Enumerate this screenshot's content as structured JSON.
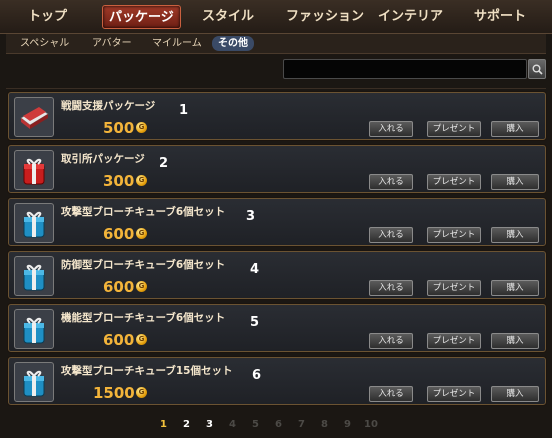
{
  "top_tabs": [
    {
      "label": "トップ",
      "active": false
    },
    {
      "label": "パッケージ",
      "active": true
    },
    {
      "label": "スタイル",
      "active": false
    },
    {
      "label": "ファッション",
      "active": false
    },
    {
      "label": "インテリア",
      "active": false
    },
    {
      "label": "サポート",
      "active": false
    }
  ],
  "sub_tabs": [
    {
      "label": "スペシャル",
      "active": false
    },
    {
      "label": "アバター",
      "active": false
    },
    {
      "label": "マイルーム",
      "active": false
    },
    {
      "label": "その他",
      "active": true
    }
  ],
  "search": {
    "value": "",
    "icon": "search-icon"
  },
  "items": [
    {
      "name": "戦闘支援パッケージ",
      "price": "500",
      "number": "1",
      "icon": "red-book-icon"
    },
    {
      "name": "取引所パッケージ",
      "price": "300",
      "number": "2",
      "icon": "red-gift-box-icon"
    },
    {
      "name": "攻撃型ブローチキューブ6個セット",
      "price": "600",
      "number": "3",
      "icon": "blue-gift-box-icon"
    },
    {
      "name": "防御型ブローチキューブ6個セット",
      "price": "600",
      "number": "4",
      "icon": "blue-gift-box-icon"
    },
    {
      "name": "機能型ブローチキューブ6個セット",
      "price": "600",
      "number": "5",
      "icon": "blue-gift-box-icon"
    },
    {
      "name": "攻撃型ブローチキューブ15個セット",
      "price": "1500",
      "number": "6",
      "icon": "blue-gift-box-icon"
    }
  ],
  "buttons": {
    "cart": "入れる",
    "present": "プレゼント",
    "buy": "購入"
  },
  "coin_label": "G",
  "pagination": {
    "pages": [
      "1",
      "2",
      "3",
      "4",
      "5",
      "6",
      "7",
      "8",
      "9",
      "10"
    ],
    "current": "1",
    "available": [
      "1",
      "2",
      "3"
    ]
  },
  "colors": {
    "price": "#f3b43a",
    "active_tab": "#8a2a1c",
    "active_subtab": "#3a4a66"
  }
}
